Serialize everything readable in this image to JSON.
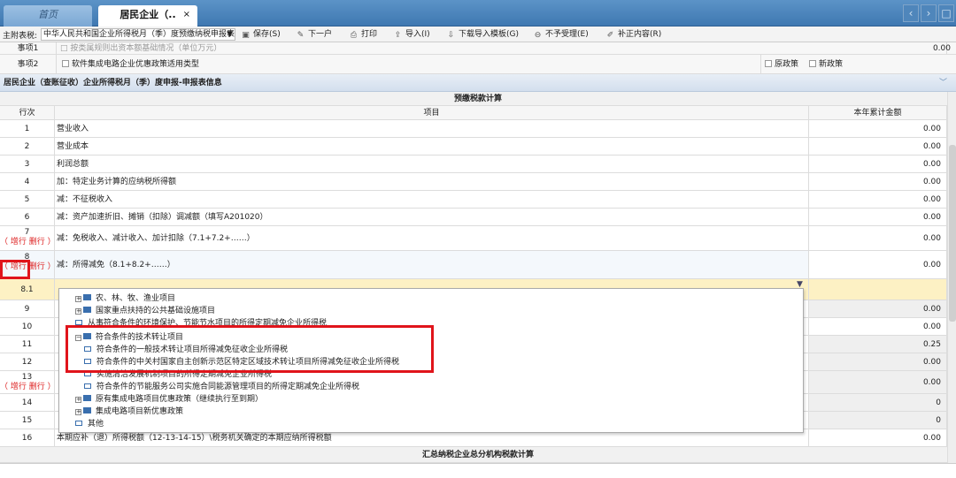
{
  "tabs": {
    "home": "首页",
    "active": "居民企业（..",
    "close": "×"
  },
  "nav": {
    "prev": "‹",
    "next": "›",
    "max": "□"
  },
  "toolbar": {
    "label": "主附表税:",
    "select": "中华人民共和国企业所得税月（季）度预缴纳税申报表",
    "save": "保存(S)",
    "next": "下一户",
    "print": "打印",
    "import": "导入(I)",
    "download_template": "下载导入模板(G)",
    "reject": "不予受理(E)",
    "supplement": "补正内容(R)"
  },
  "items": {
    "item1_label": "事项1",
    "item1_text": "□ 按类属规则出资本额基础情况（单位万元）",
    "item1_amt": "0.00",
    "item2_label": "事项2",
    "item2_text": "软件集成电路企业优惠政策适用类型",
    "item2_opt1": "原政策",
    "item2_opt2": "新政策"
  },
  "section": {
    "title": "居民企业（查账征收）企业所得税月（季）度申报-申报表信息",
    "chevron": "﹀"
  },
  "table": {
    "caption": "预缴税款计算",
    "col_no": "行次",
    "col_item": "项目",
    "col_amt": "本年累计金额",
    "add_del": "（ 增行 删行 ）",
    "rows": [
      {
        "no": "1",
        "label": "营业收入",
        "amt": "0.00"
      },
      {
        "no": "2",
        "label": "营业成本",
        "amt": "0.00"
      },
      {
        "no": "3",
        "label": "利润总额",
        "amt": "0.00"
      },
      {
        "no": "4",
        "label": "加：特定业务计算的应纳税所得额",
        "amt": "0.00"
      },
      {
        "no": "5",
        "label": "减：不征税收入",
        "amt": "0.00"
      },
      {
        "no": "6",
        "label": "减：资产加速折旧、摊销（扣除）调减额（填写A201020）",
        "amt": "0.00"
      },
      {
        "no": "7",
        "label": "减：免税收入、减计收入、加计扣除（7.1+7.2+……）",
        "amt": "0.00"
      },
      {
        "no": "8",
        "label": "减：所得减免（8.1+8.2+……）",
        "amt": "0.00"
      },
      {
        "no": "8.1",
        "label": "",
        "amt": ""
      },
      {
        "no": "9",
        "label": "",
        "amt": "0.00"
      },
      {
        "no": "10",
        "label": "",
        "amt": "0.00"
      },
      {
        "no": "11",
        "label": "",
        "amt": "0.25"
      },
      {
        "no": "12",
        "label": "",
        "amt": "0.00"
      },
      {
        "no": "13",
        "label": "",
        "amt": "0.00"
      },
      {
        "no": "14",
        "label": "",
        "amt": "0"
      },
      {
        "no": "15",
        "label": "",
        "amt": "0"
      },
      {
        "no": "16",
        "label": "本期应补（退）所得税额（12-13-14-15）\\税务机关确定的本期应纳所得税额",
        "amt": "0.00"
      }
    ],
    "footer": "汇总纳税企业总分机构税款计算"
  },
  "dropdown": {
    "items": [
      "农、林、牧、渔业项目",
      "国家重点扶持的公共基础设施项目",
      "从事符合条件的环境保护、节能节水项目的所得定期减免企业所得税",
      "符合条件的技术转让项目",
      "符合条件的一般技术转让项目所得减免征收企业所得税",
      "符合条件的中关村国家自主创新示范区特定区域技术转让项目所得减免征收企业所得税",
      "实施清洁发展机制项目的所得定期减免企业所得税",
      "符合条件的节能服务公司实施合同能源管理项目的所得定期减免企业所得税",
      "原有集成电路项目优惠政策（继续执行至到期）",
      "集成电路项目新优惠政策",
      "其他"
    ]
  }
}
